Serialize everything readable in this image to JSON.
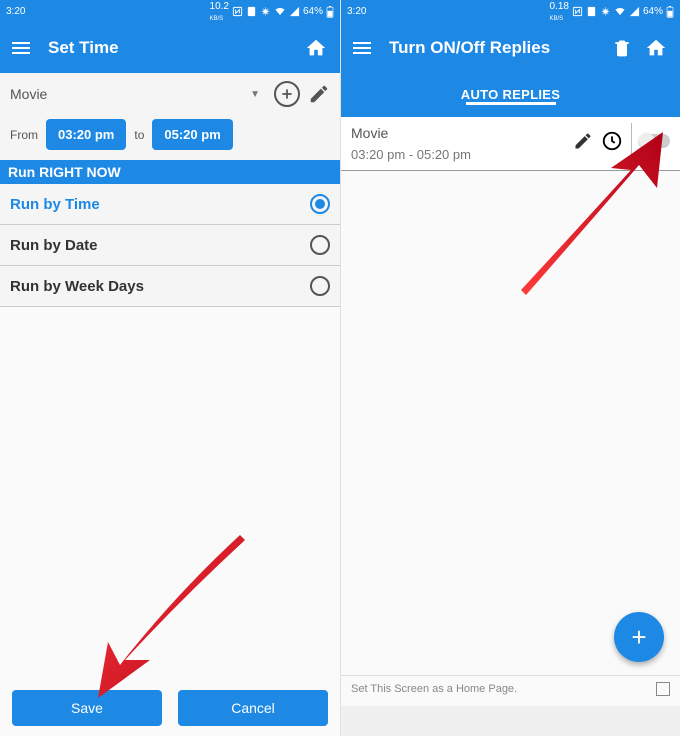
{
  "status": {
    "time": "3:20",
    "net_left": "10.2",
    "net_unit_left": "KB/S",
    "net_right": "0.18",
    "net_unit_right": "KB/S",
    "battery": "64%"
  },
  "left": {
    "title": "Set Time",
    "dropdown_value": "Movie",
    "from_label": "From",
    "from_time": "03:20 pm",
    "to_label": "to",
    "to_time": "05:20 pm",
    "banner": "Run RIGHT NOW",
    "options": [
      {
        "label": "Run by Time",
        "checked": true
      },
      {
        "label": "Run by Date",
        "checked": false
      },
      {
        "label": "Run by Week Days",
        "checked": false
      }
    ],
    "save": "Save",
    "cancel": "Cancel"
  },
  "right": {
    "title": "Turn ON/Off Replies",
    "tab": "AUTO REPLIES",
    "item_name": "Movie",
    "item_time": "03:20 pm - 05:20 pm",
    "home_text": "Set This Screen as a Home Page.",
    "fab": "+"
  }
}
